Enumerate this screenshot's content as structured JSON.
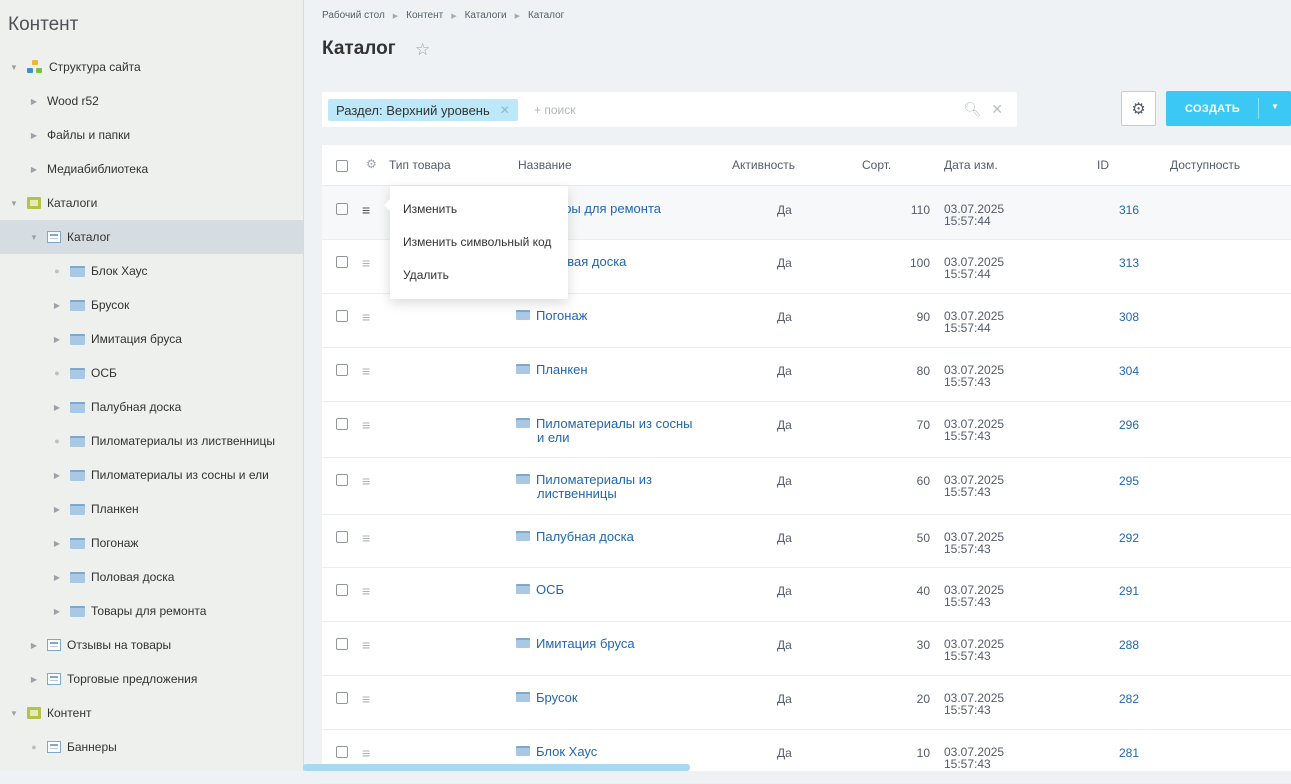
{
  "sidebar": {
    "title": "Контент",
    "items": [
      {
        "label": "Структура сайта",
        "indent": 0,
        "toggle": "open",
        "icon": "structure-icon"
      },
      {
        "label": "Wood r52",
        "indent": 1,
        "toggle": "closed",
        "icon": ""
      },
      {
        "label": "Файлы и папки",
        "indent": 1,
        "toggle": "closed",
        "icon": ""
      },
      {
        "label": "Медиабиблиотека",
        "indent": 1,
        "toggle": "closed",
        "icon": ""
      },
      {
        "label": "Каталоги",
        "indent": 0,
        "toggle": "open",
        "icon": "iblock-type-icon"
      },
      {
        "label": "Каталог",
        "indent": 1,
        "toggle": "open",
        "icon": "list-icon",
        "active": true
      },
      {
        "label": "Блок Хаус",
        "indent": 2,
        "toggle": "leaf",
        "icon": "folder-icon"
      },
      {
        "label": "Брусок",
        "indent": 2,
        "toggle": "closed",
        "icon": "folder-icon"
      },
      {
        "label": "Имитация бруса",
        "indent": 2,
        "toggle": "closed",
        "icon": "folder-icon"
      },
      {
        "label": "ОСБ",
        "indent": 2,
        "toggle": "leaf",
        "icon": "folder-icon"
      },
      {
        "label": "Палубная доска",
        "indent": 2,
        "toggle": "closed",
        "icon": "folder-icon"
      },
      {
        "label": "Пиломатериалы из лиственницы",
        "indent": 2,
        "toggle": "leaf",
        "icon": "folder-icon"
      },
      {
        "label": "Пиломатериалы из сосны и ели",
        "indent": 2,
        "toggle": "closed",
        "icon": "folder-icon"
      },
      {
        "label": "Планкен",
        "indent": 2,
        "toggle": "closed",
        "icon": "folder-icon"
      },
      {
        "label": "Погонаж",
        "indent": 2,
        "toggle": "closed",
        "icon": "folder-icon"
      },
      {
        "label": "Половая доска",
        "indent": 2,
        "toggle": "closed",
        "icon": "folder-icon"
      },
      {
        "label": "Товары для ремонта",
        "indent": 2,
        "toggle": "closed",
        "icon": "folder-icon"
      },
      {
        "label": "Отзывы на товары",
        "indent": 1,
        "toggle": "closed",
        "icon": "list-icon"
      },
      {
        "label": "Торговые предложения",
        "indent": 1,
        "toggle": "closed",
        "icon": "list-icon"
      },
      {
        "label": "Контент",
        "indent": 0,
        "toggle": "open",
        "icon": "iblock-type-icon"
      },
      {
        "label": "Баннеры",
        "indent": 1,
        "toggle": "leaf",
        "icon": "list-icon"
      },
      {
        "label": "",
        "indent": 1,
        "toggle": "leaf",
        "icon": "list-icon"
      }
    ]
  },
  "breadcrumbs": [
    "Рабочий стол",
    "Контент",
    "Каталоги",
    "Каталог"
  ],
  "page": {
    "title": "Каталог"
  },
  "filter": {
    "chip": "Раздел: Верхний уровень",
    "placeholder": "+ поиск"
  },
  "toolbar": {
    "create_label": "СОЗДАТЬ"
  },
  "grid": {
    "columns": {
      "type": "Тип товара",
      "name": "Название",
      "active": "Активность",
      "sort": "Сорт.",
      "date": "Дата изм.",
      "id": "ID",
      "avail": "Доступность"
    },
    "rows": [
      {
        "name": "Товары для ремонта",
        "active": "Да",
        "sort": "110",
        "date": "03.07.2025",
        "time": "15:57:44",
        "id": "316"
      },
      {
        "name": "Половая доска",
        "active": "Да",
        "sort": "100",
        "date": "03.07.2025",
        "time": "15:57:44",
        "id": "313"
      },
      {
        "name": "Погонаж",
        "active": "Да",
        "sort": "90",
        "date": "03.07.2025",
        "time": "15:57:44",
        "id": "308"
      },
      {
        "name": "Планкен",
        "active": "Да",
        "sort": "80",
        "date": "03.07.2025",
        "time": "15:57:43",
        "id": "304"
      },
      {
        "name": "Пиломатериалы из сосны",
        "name2": "и ели",
        "active": "Да",
        "sort": "70",
        "date": "03.07.2025",
        "time": "15:57:43",
        "id": "296"
      },
      {
        "name": "Пиломатериалы из",
        "name2": "лиственницы",
        "active": "Да",
        "sort": "60",
        "date": "03.07.2025",
        "time": "15:57:43",
        "id": "295"
      },
      {
        "name": "Палубная доска",
        "active": "Да",
        "sort": "50",
        "date": "03.07.2025",
        "time": "15:57:43",
        "id": "292"
      },
      {
        "name": "ОСБ",
        "active": "Да",
        "sort": "40",
        "date": "03.07.2025",
        "time": "15:57:43",
        "id": "291"
      },
      {
        "name": "Имитация бруса",
        "active": "Да",
        "sort": "30",
        "date": "03.07.2025",
        "time": "15:57:43",
        "id": "288"
      },
      {
        "name": "Брусок",
        "active": "Да",
        "sort": "20",
        "date": "03.07.2025",
        "time": "15:57:43",
        "id": "282"
      },
      {
        "name": "Блок Хаус",
        "active": "Да",
        "sort": "10",
        "date": "03.07.2025",
        "time": "15:57:43",
        "id": "281"
      }
    ]
  },
  "context_menu": {
    "items": [
      "Изменить",
      "Изменить символьный код",
      "Удалить"
    ]
  }
}
